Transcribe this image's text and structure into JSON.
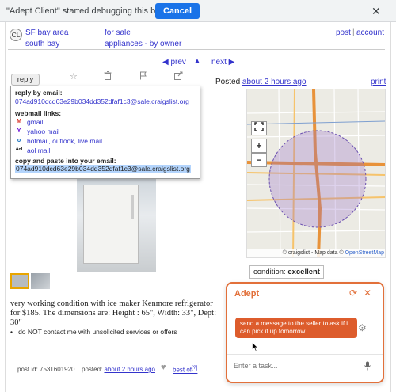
{
  "debug_banner": {
    "text": "\"Adept Client\" started debugging this browser",
    "cancel_label": "Cancel",
    "close_glyph": "✕"
  },
  "header": {
    "logo_text": "CL",
    "area": "SF bay area",
    "subarea": "south bay",
    "section": "for sale",
    "category": "appliances - by owner",
    "post_link": "post",
    "account_link": "account"
  },
  "nav": {
    "prev": "◀ prev",
    "up": "▲",
    "next": "next ▶"
  },
  "actions": {
    "reply": "reply",
    "icons": [
      "star-icon",
      "trash-icon",
      "flag-icon",
      "share-icon"
    ],
    "posted_prefix": "Posted ",
    "posted_time": "about 2 hours ago",
    "print": "print"
  },
  "reply_popup": {
    "reply_by_email_label": "reply by email:",
    "email": "074ad910dcd63e29b034dd352dfaf1c3@sale.craigslist.org",
    "webmail_label": "webmail links:",
    "webmail_links": [
      {
        "icon": "gmail-icon",
        "glyph": "M",
        "color": "#d93025",
        "label": "gmail"
      },
      {
        "icon": "yahoo-icon",
        "glyph": "Y",
        "color": "#6001d2",
        "label": "yahoo mail"
      },
      {
        "icon": "outlook-icon",
        "glyph": "o",
        "color": "#0f6cbd",
        "label": "hotmail, outlook, live mail"
      },
      {
        "icon": "aol-icon",
        "glyph": "Aol",
        "color": "#000000",
        "label": "aol mail"
      }
    ],
    "copy_label": "copy and paste into your email:",
    "copy_email": "074ad910dcd63e29b034dd352dfaf1c3@sale.craigslist.org"
  },
  "map": {
    "zoom_in": "+",
    "zoom_out": "−",
    "fullscreen_icon": "fullscreen-icon",
    "attribution_prefix": "© craigslist - Map data © ",
    "attribution_link": "OpenStreetMap"
  },
  "condition": {
    "label": "condition: ",
    "value": "excellent"
  },
  "body": {
    "description": "very working condition with ice maker Kenmore refrigerator for $185. The dimensions are: Height : 65\", Width: 33\", Dept: 30\"",
    "notice": "do NOT contact me with unsolicited services or offers"
  },
  "footer": {
    "post_id": "post id: 7531601920",
    "posted_prefix": "posted: ",
    "posted_time": "about 2 hours ago",
    "best_of": "best of",
    "best_of_sup": "[?]"
  },
  "adept": {
    "title": "Adept",
    "message": "send a message to the seller to ask if i can pick it up tomorrow",
    "input_placeholder": "Enter a task...",
    "accent_color": "#e2703a"
  }
}
